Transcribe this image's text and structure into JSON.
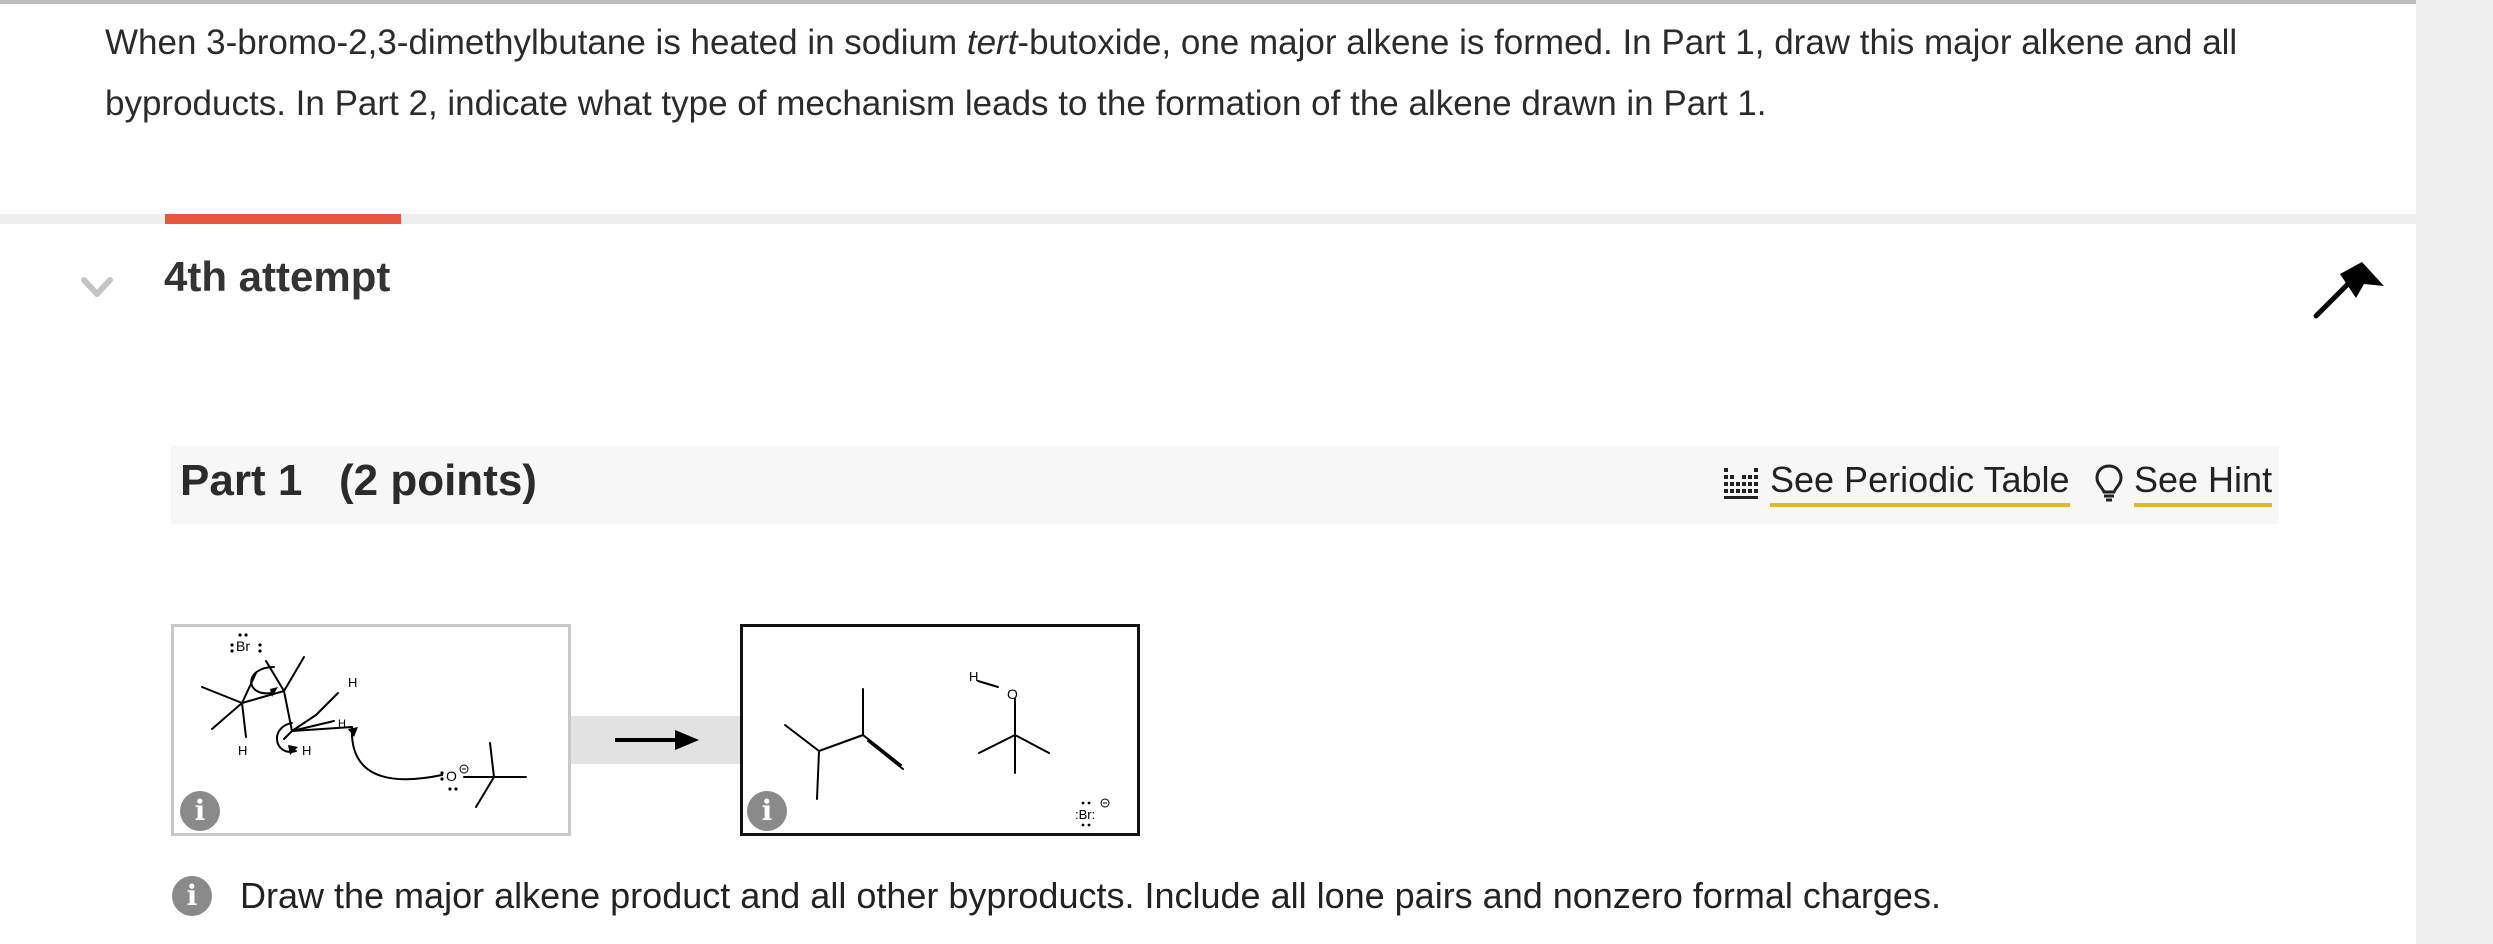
{
  "question": {
    "part_a": "When 3-bromo-2,3-dimethylbutane is heated in sodium ",
    "part_italic": "tert",
    "part_b": "-butoxide, one major alkene is formed. In Part 1, draw this major alkene and all byproducts. In Part 2, indicate what type of mechanism leads to the formation of the alkene drawn in Part 1."
  },
  "attempt": {
    "title": "4th attempt"
  },
  "part": {
    "title": "Part 1",
    "points": "(2 points)",
    "periodic_label": "See Periodic Table",
    "hint_label": "See Hint"
  },
  "reactant_panel": {
    "atoms": {
      "br": "Br",
      "h1": "H",
      "h2": "H",
      "h3": "H",
      "h4": "H",
      "o": "O"
    },
    "info_glyph": "i"
  },
  "product_panel": {
    "atoms": {
      "h": "H",
      "o": "O",
      "br": ":Br:"
    },
    "info_glyph": "i"
  },
  "instructions": {
    "info_glyph": "i",
    "text": "Draw the major alkene product and all other byproducts. Include all lone pairs and nonzero formal charges."
  },
  "colors": {
    "accent": "#e4573d",
    "link_underline": "#e3b432"
  }
}
